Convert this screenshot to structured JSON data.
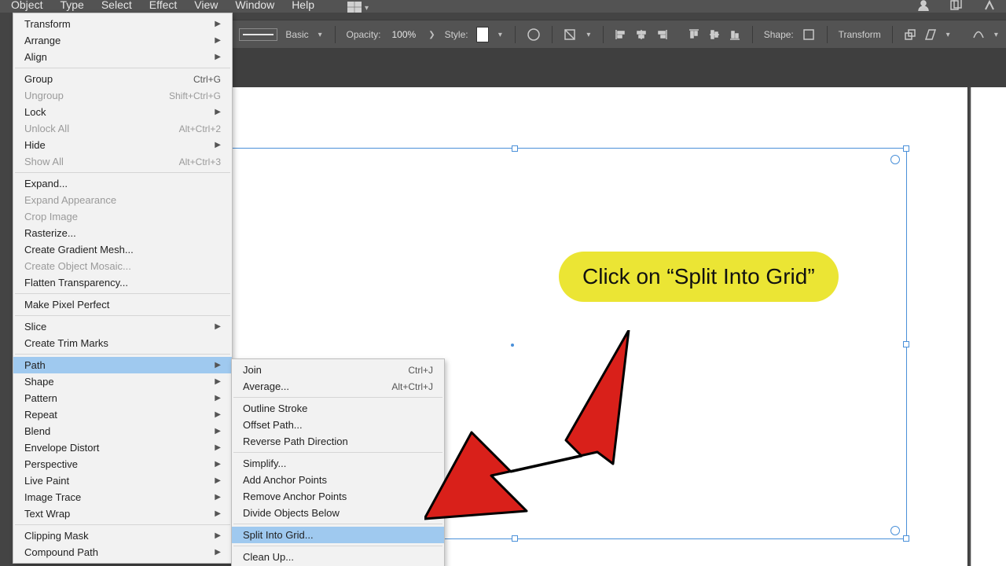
{
  "menubar": {
    "items": [
      "Object",
      "Type",
      "Select",
      "Effect",
      "View",
      "Window",
      "Help"
    ]
  },
  "optionsbar": {
    "stroke_preset": "Basic",
    "opacity_label": "Opacity:",
    "opacity_value": "100%",
    "style_label": "Style:",
    "shape_label": "Shape:",
    "transform_label": "Transform"
  },
  "object_menu": [
    {
      "label": "Transform",
      "arrow": true
    },
    {
      "label": "Arrange",
      "arrow": true
    },
    {
      "label": "Align",
      "arrow": true
    },
    {
      "sep": true
    },
    {
      "label": "Group",
      "shortcut": "Ctrl+G"
    },
    {
      "label": "Ungroup",
      "shortcut": "Shift+Ctrl+G",
      "disabled": true
    },
    {
      "label": "Lock",
      "arrow": true
    },
    {
      "label": "Unlock All",
      "shortcut": "Alt+Ctrl+2",
      "disabled": true
    },
    {
      "label": "Hide",
      "arrow": true
    },
    {
      "label": "Show All",
      "shortcut": "Alt+Ctrl+3",
      "disabled": true
    },
    {
      "sep": true
    },
    {
      "label": "Expand..."
    },
    {
      "label": "Expand Appearance",
      "disabled": true
    },
    {
      "label": "Crop Image",
      "disabled": true
    },
    {
      "label": "Rasterize..."
    },
    {
      "label": "Create Gradient Mesh..."
    },
    {
      "label": "Create Object Mosaic...",
      "disabled": true
    },
    {
      "label": "Flatten Transparency..."
    },
    {
      "sep": true
    },
    {
      "label": "Make Pixel Perfect"
    },
    {
      "sep": true
    },
    {
      "label": "Slice",
      "arrow": true
    },
    {
      "label": "Create Trim Marks"
    },
    {
      "sep": true
    },
    {
      "label": "Path",
      "arrow": true,
      "highlight": true
    },
    {
      "label": "Shape",
      "arrow": true
    },
    {
      "label": "Pattern",
      "arrow": true
    },
    {
      "label": "Repeat",
      "arrow": true
    },
    {
      "label": "Blend",
      "arrow": true
    },
    {
      "label": "Envelope Distort",
      "arrow": true
    },
    {
      "label": "Perspective",
      "arrow": true
    },
    {
      "label": "Live Paint",
      "arrow": true
    },
    {
      "label": "Image Trace",
      "arrow": true
    },
    {
      "label": "Text Wrap",
      "arrow": true
    },
    {
      "sep": true
    },
    {
      "label": "Clipping Mask",
      "arrow": true
    },
    {
      "label": "Compound Path",
      "arrow": true
    }
  ],
  "path_menu": [
    {
      "label": "Join",
      "shortcut": "Ctrl+J"
    },
    {
      "label": "Average...",
      "shortcut": "Alt+Ctrl+J"
    },
    {
      "sep": true
    },
    {
      "label": "Outline Stroke"
    },
    {
      "label": "Offset Path..."
    },
    {
      "label": "Reverse Path Direction"
    },
    {
      "sep": true
    },
    {
      "label": "Simplify..."
    },
    {
      "label": "Add Anchor Points"
    },
    {
      "label": "Remove Anchor Points"
    },
    {
      "label": "Divide Objects Below"
    },
    {
      "sep": true
    },
    {
      "label": "Split Into Grid...",
      "highlight": true
    },
    {
      "sep": true
    },
    {
      "label": "Clean Up..."
    }
  ],
  "annotation": {
    "text": "Click on “Split Into Grid”"
  }
}
